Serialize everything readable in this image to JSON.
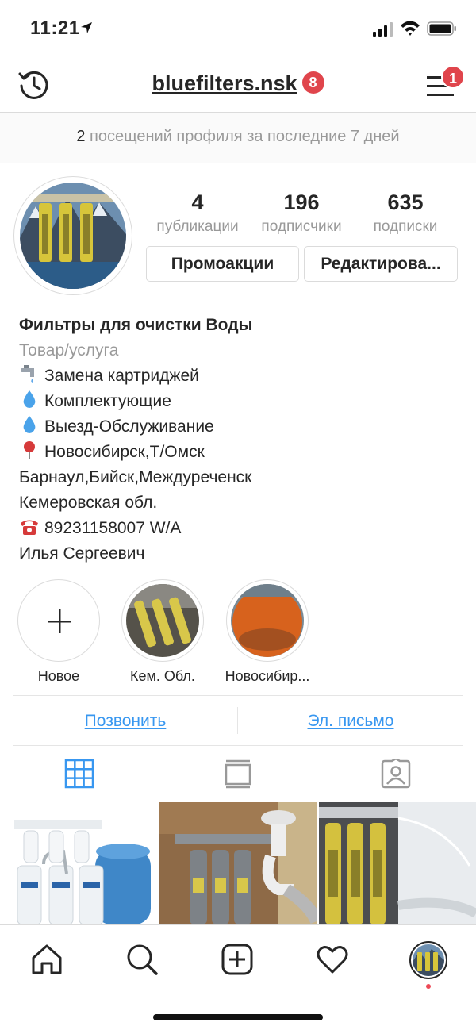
{
  "status": {
    "time": "11:21"
  },
  "header": {
    "username": "bluefilters.nsk",
    "notif_badge": "8",
    "menu_badge": "1"
  },
  "visits": {
    "count": "2",
    "text": " посещений профиля за последние 7 дней"
  },
  "stats": [
    {
      "num": "4",
      "label": "публикации"
    },
    {
      "num": "196",
      "label": "подписчики"
    },
    {
      "num": "635",
      "label": "подписки"
    }
  ],
  "buttons": {
    "promo": "Промоакции",
    "edit": "Редактирова..."
  },
  "bio": {
    "name": "Фильтры для очистки Воды",
    "category": "Товар/услуга",
    "lines": [
      "Замена картриджей",
      "Комплектующие",
      "Выезд-Обслуживание",
      "Новосибирск,Т/Омск",
      "Барнаул,Бийск,Междуреченск",
      "Кемеровская обл.",
      "89231158007 W/A",
      "Илья Сергеевич"
    ]
  },
  "highlights": [
    {
      "label": "Новое"
    },
    {
      "label": "Кем. Обл."
    },
    {
      "label": "Новосибир..."
    }
  ],
  "contact": {
    "call": "Позвонить",
    "email": "Эл. письмо"
  },
  "colors": {
    "link": "#3897f0",
    "badge": "#e0454c",
    "active_tab": "#3897f0"
  }
}
